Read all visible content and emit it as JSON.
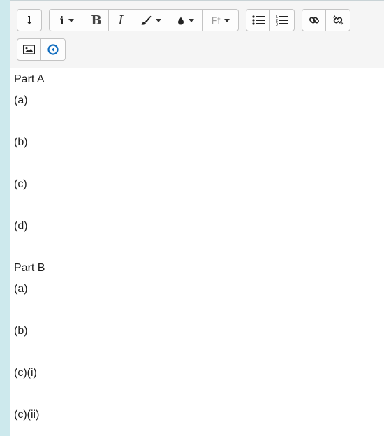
{
  "toolbar": {
    "row1": [
      {
        "name": "format-button",
        "icon": "arrow-down-right-icon"
      },
      {
        "name": "paragraph-style-button",
        "icon": "info-icon"
      },
      {
        "name": "bold-button",
        "icon": "bold-icon",
        "label": "B"
      },
      {
        "name": "italic-button",
        "icon": "italic-icon",
        "label": "I"
      },
      {
        "name": "text-color-button",
        "icon": "brush-icon"
      },
      {
        "name": "background-color-button",
        "icon": "drop-icon"
      },
      {
        "name": "font-family-button",
        "icon": "font-icon",
        "label": "Ff"
      },
      {
        "name": "unordered-list-button",
        "icon": "bullet-list-icon"
      },
      {
        "name": "ordered-list-button",
        "icon": "numbered-list-icon"
      },
      {
        "name": "link-button",
        "icon": "link-icon"
      },
      {
        "name": "unlink-button",
        "icon": "unlink-icon"
      }
    ],
    "row2": [
      {
        "name": "image-button",
        "icon": "image-icon"
      },
      {
        "name": "media-button",
        "icon": "media-play-icon"
      }
    ],
    "accent_color": "#0f6cbf"
  },
  "content": {
    "lines": [
      "Part A",
      "(a)",
      "(b)",
      "(c)",
      "(d)",
      "Part B",
      "(a)",
      "(b)",
      "(c)(i)",
      "(c)(ii)"
    ]
  }
}
